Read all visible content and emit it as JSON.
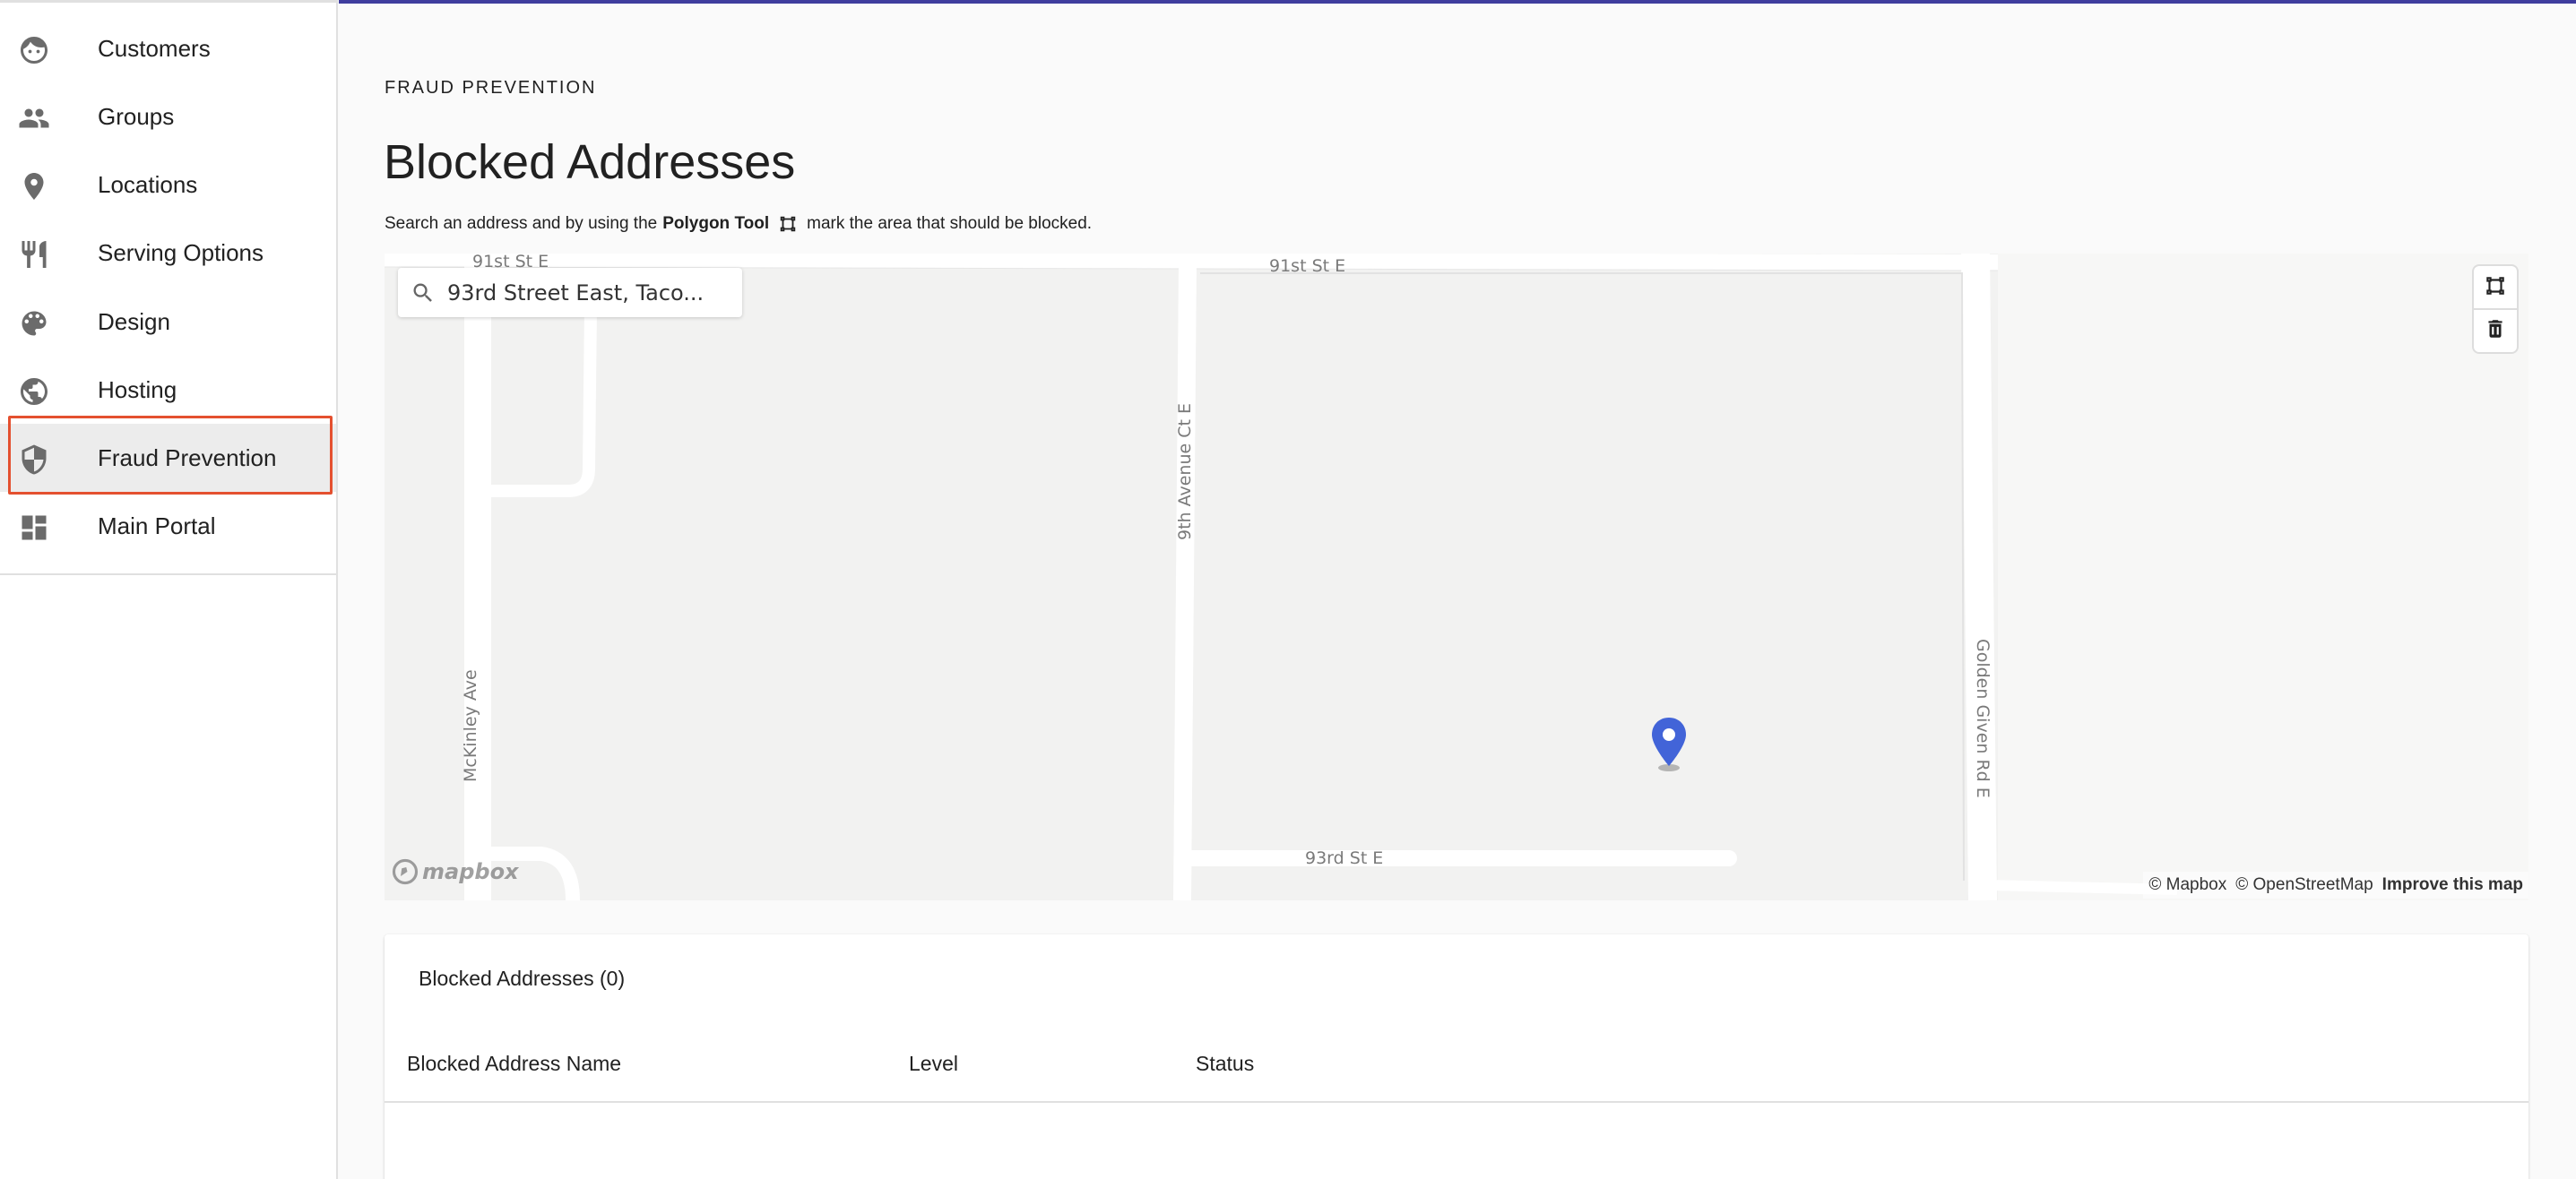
{
  "sidebar": {
    "items": [
      {
        "label": "Customers",
        "icon": "face-icon"
      },
      {
        "label": "Groups",
        "icon": "people-icon"
      },
      {
        "label": "Locations",
        "icon": "location-pin-icon"
      },
      {
        "label": "Serving Options",
        "icon": "fork-knife-icon"
      },
      {
        "label": "Design",
        "icon": "palette-icon"
      },
      {
        "label": "Hosting",
        "icon": "globe-icon"
      },
      {
        "label": "Fraud Prevention",
        "icon": "shield-icon",
        "active": true
      },
      {
        "label": "Main Portal",
        "icon": "dashboard-icon"
      }
    ]
  },
  "page": {
    "overline": "FRAUD PREVENTION",
    "title": "Blocked Addresses",
    "instructions": {
      "before": "Search an address and by using the",
      "tool": "Polygon Tool",
      "after": "mark the area that should be blocked."
    }
  },
  "map": {
    "search": {
      "value": "93rd Street East, Taco..."
    },
    "roads": {
      "r91_left": "91st St E",
      "r91_right": "91st St E",
      "ninth": "9th Avenue Ct E",
      "mckinley": "McKinley Ave",
      "golden": "Golden Given Rd E",
      "r93": "93rd St E"
    },
    "logo": "mapbox",
    "attribution": {
      "mapbox": "© Mapbox",
      "osm": "© OpenStreetMap",
      "improve": "Improve this map"
    },
    "controls": [
      "polygon-tool-icon",
      "trash-icon"
    ],
    "marker_color": "#4264d8"
  },
  "table": {
    "title": "Blocked Addresses (0)",
    "columns": {
      "name": "Blocked Address Name",
      "level": "Level",
      "status": "Status"
    }
  },
  "colors": {
    "accent_bar": "#3f3d9e",
    "active_outline": "#e4502f"
  }
}
